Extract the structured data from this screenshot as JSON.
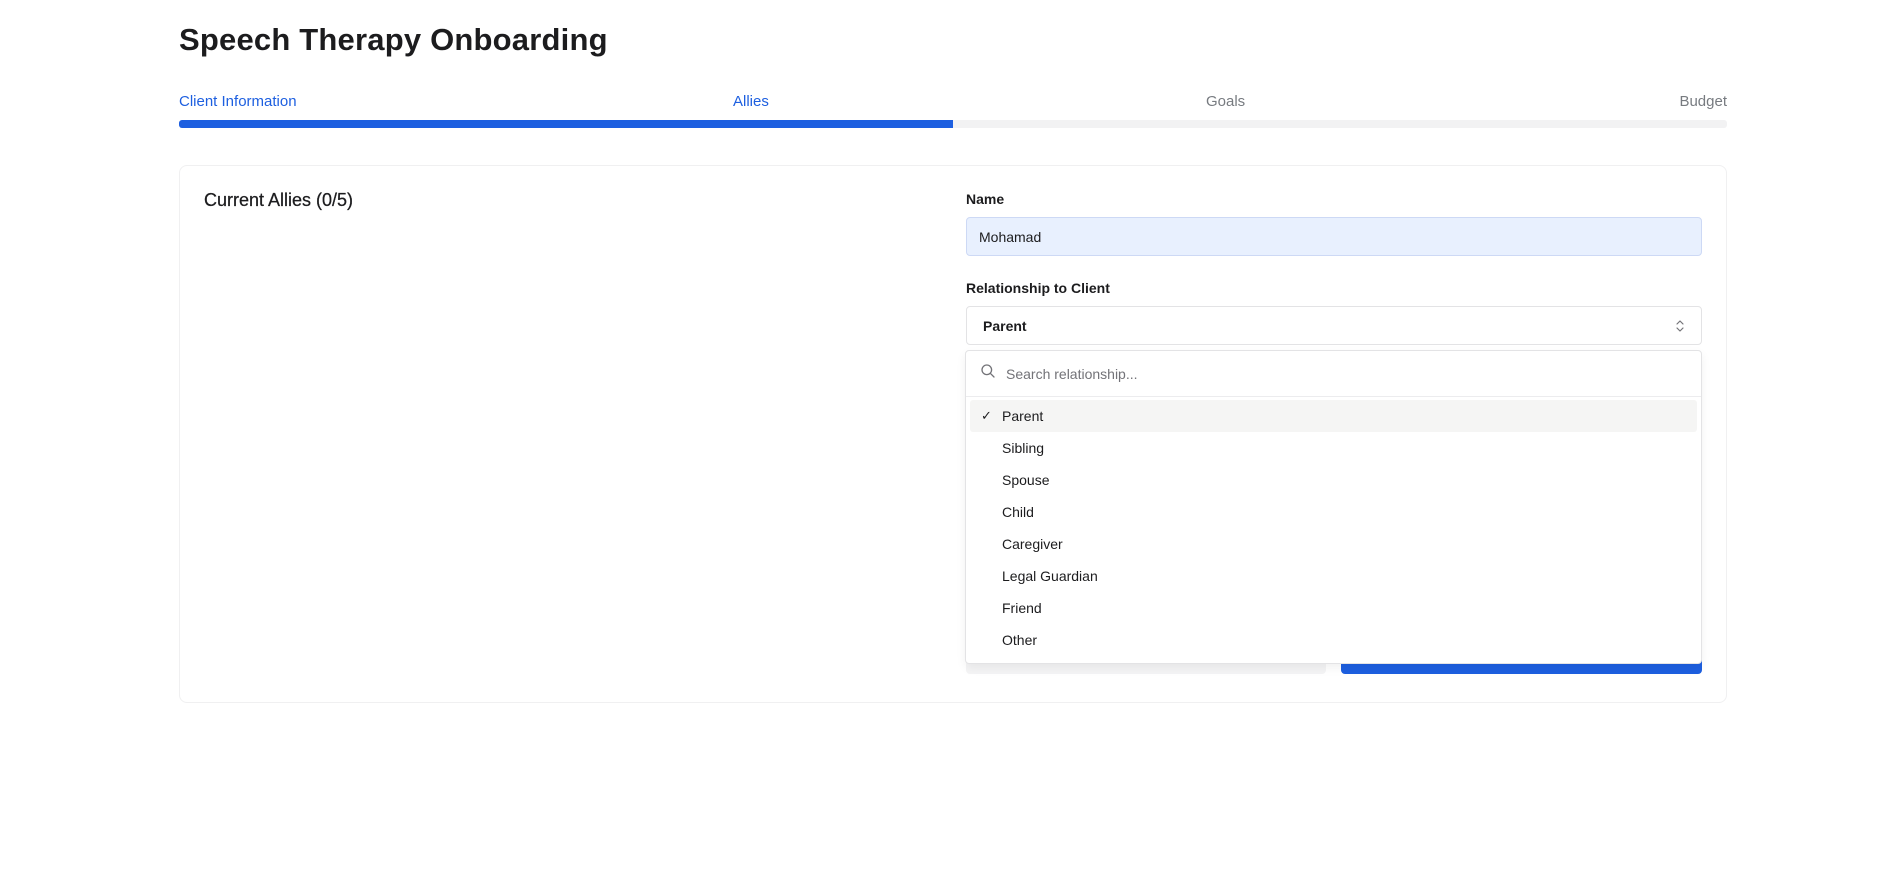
{
  "header": {
    "title": "Speech Therapy Onboarding"
  },
  "steps": [
    {
      "label": "Client Information",
      "status": "completed"
    },
    {
      "label": "Allies",
      "status": "current"
    },
    {
      "label": "Goals",
      "status": "pending"
    },
    {
      "label": "Budget",
      "status": "pending"
    }
  ],
  "progress": {
    "percent": 50,
    "color": "#1d5fe0"
  },
  "allies": {
    "heading": "Current Allies (0/5)"
  },
  "form": {
    "name_label": "Name",
    "name_value": "Mohamad",
    "relationship_label": "Relationship to Client",
    "relationship_value": "Parent"
  },
  "relationship_dropdown": {
    "search_placeholder": "Search relationship...",
    "options": [
      {
        "label": "Parent",
        "selected": true
      },
      {
        "label": "Sibling",
        "selected": false
      },
      {
        "label": "Spouse",
        "selected": false
      },
      {
        "label": "Child",
        "selected": false
      },
      {
        "label": "Caregiver",
        "selected": false
      },
      {
        "label": "Legal Guardian",
        "selected": false
      },
      {
        "label": "Friend",
        "selected": false
      },
      {
        "label": "Other",
        "selected": false
      }
    ],
    "check_glyph": "✓"
  },
  "icons": {
    "search": "search-icon",
    "select_chevrons": "chevron-up-down-icon",
    "check": "check-icon"
  },
  "colors": {
    "accent": "#1d5fe0",
    "track": "#f2f2f3",
    "input_filled_bg": "#e8f0fe",
    "selected_option_bg": "#f5f5f4"
  }
}
